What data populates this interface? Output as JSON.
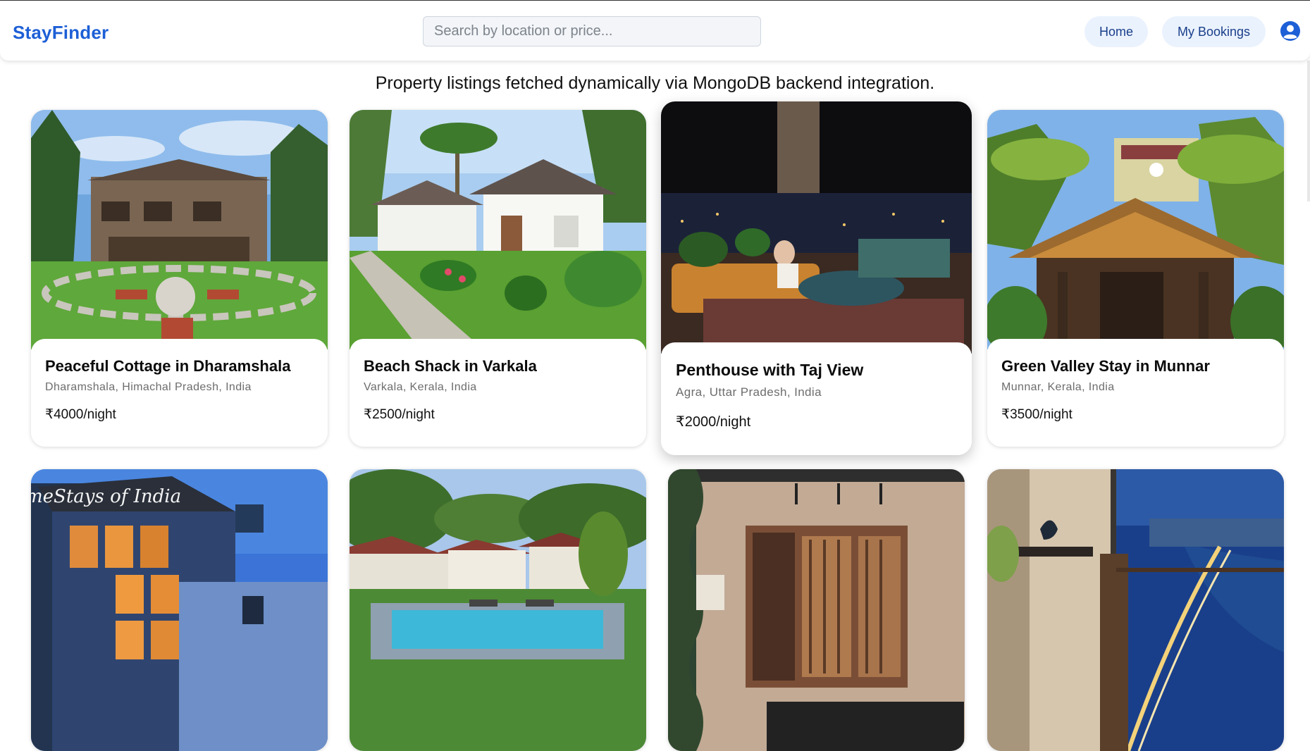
{
  "header": {
    "brand": "StayFinder",
    "search_placeholder": "Search by location or price...",
    "nav": {
      "home": "Home",
      "bookings": "My Bookings"
    },
    "profile_icon": "user-circle-icon",
    "accent_color": "#1d5fd6"
  },
  "main": {
    "subtitle": "Property listings fetched dynamically via MongoDB backend integration.",
    "listings": [
      {
        "title": "Peaceful Cottage in Dharamshala",
        "location": "Dharamshala, Himachal Pradesh, India",
        "price": "₹4000/night",
        "image": "stone-cottage-garden-photo"
      },
      {
        "title": "Beach Shack in Varkala",
        "location": "Varkala, Kerala, India",
        "price": "₹2500/night",
        "image": "white-cottages-palms-photo"
      },
      {
        "title": "Penthouse with Taj View",
        "location": "Agra, Uttar Pradesh, India",
        "price": "₹2000/night",
        "image": "night-terrace-lounge-photo"
      },
      {
        "title": "Green Valley Stay in Munnar",
        "location": "Munnar, Kerala, India",
        "price": "₹3500/night",
        "image": "wooden-homestay-palms-photo"
      },
      {
        "title": "",
        "location": "",
        "price": "",
        "image": "lit-glass-villa-dusk-photo",
        "watermark": "meStays of India"
      },
      {
        "title": "",
        "location": "",
        "price": "",
        "image": "resort-pool-garden-photo"
      },
      {
        "title": "",
        "location": "",
        "price": "",
        "image": "modern-interior-shelves-photo"
      },
      {
        "title": "",
        "location": "",
        "price": "",
        "image": "seaside-balcony-night-photo"
      }
    ]
  }
}
